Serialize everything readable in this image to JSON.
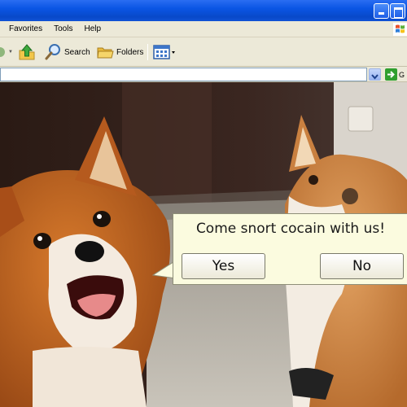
{
  "menu": {
    "items": [
      "Favorites",
      "Tools",
      "Help"
    ]
  },
  "toolbar": {
    "search_label": "Search",
    "folders_label": "Folders"
  },
  "address": {
    "value": "",
    "go_label": "G"
  },
  "dialog": {
    "message": "Come snort cocain with us!",
    "yes_label": "Yes",
    "no_label": "No"
  },
  "colors": {
    "titlebar": "#0a55e4",
    "chrome": "#ece9d8",
    "balloon": "#fbfbdf",
    "go_green": "#2f9f2f"
  },
  "icons": [
    "minimize-icon",
    "maximize-icon",
    "windows-logo-icon",
    "forward-arrow-icon",
    "up-folder-icon",
    "search-icon",
    "folders-icon",
    "views-icon",
    "dropdown-arrow-icon",
    "go-arrow-icon"
  ],
  "image": {
    "subject": "fox-photo"
  }
}
